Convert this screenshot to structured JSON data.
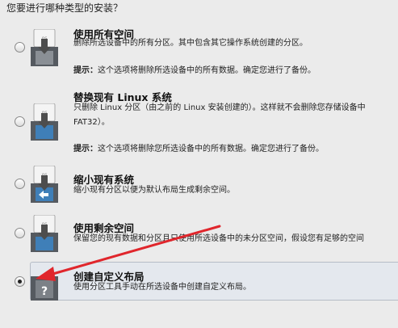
{
  "question": "您要进行哪种类型的安装？",
  "options": [
    {
      "title": "使用所有空间",
      "description": [
        "删除所选设备中的所有分区。其中包含其它操作系统创建的分区。"
      ],
      "tip_label": "提示：",
      "tip_text": "这个选项将删除所选设备中的所有数据。确定您进行了备份。",
      "selected": false,
      "icon": "os-drive-remove-all-icon"
    },
    {
      "title": "替换现有 Linux 系统",
      "description": [
        "只删除 Linux 分区（由之前的 Linux 安装创建的）。这样就不会删除您存储设备中",
        "FAT32）。"
      ],
      "tip_label": "提示：",
      "tip_text": "这个选项将删除您所选设备中的所有数据。确定您进行了备份。",
      "selected": false,
      "icon": "os-drive-replace-linux-icon"
    },
    {
      "title": "缩小现有系统",
      "description": [
        "缩小现有分区以便为默认布局生成剩余空间。"
      ],
      "selected": false,
      "icon": "os-drive-shrink-icon"
    },
    {
      "title": "使用剩余空间",
      "description": [
        "保留您的现有数据和分区且只使用所选设备中的未分区空间，假设您有足够的空间"
      ],
      "selected": false,
      "icon": "os-drive-free-space-icon"
    },
    {
      "title": "创建自定义布局",
      "description": [
        "使用分区工具手动在所选设备中创建自定义布局。"
      ],
      "selected": true,
      "icon": "custom-layout-question-icon"
    }
  ],
  "icon_label": "os",
  "custom_icon_glyph": "?",
  "colors": {
    "background": "#ebebeb",
    "selected_row": "#e4e8ee",
    "icon_blue": "#3f7fb8",
    "icon_dark": "#555a60",
    "arrow_red": "#e0262c"
  }
}
